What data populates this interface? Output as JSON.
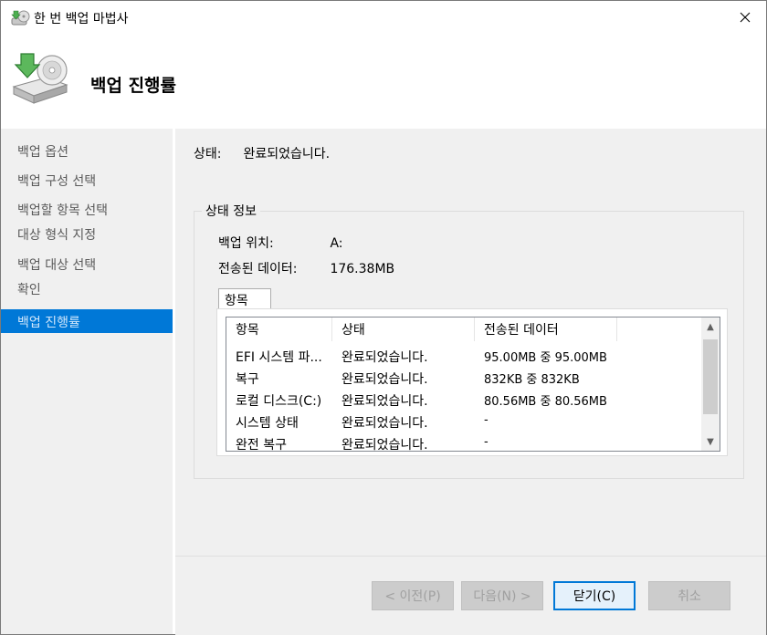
{
  "window": {
    "title": "한 번 백업 마법사"
  },
  "header": {
    "title": "백업 진행률"
  },
  "sidebar": {
    "items": [
      {
        "label": "백업 옵션"
      },
      {
        "label": "백업 구성 선택"
      },
      {
        "label": "백업할 항목 선택"
      },
      {
        "label": "대상 형식 지정"
      },
      {
        "label": "백업 대상 선택"
      },
      {
        "label": "확인"
      },
      {
        "label": "백업 진행률"
      }
    ],
    "active_index": 6
  },
  "status": {
    "label": "상태:",
    "value": "완료되었습니다."
  },
  "info_group": {
    "title": "상태 정보",
    "location_label": "백업 위치:",
    "location_value": "A:",
    "transferred_label": "전송된 데이터:",
    "transferred_value": "176.38MB"
  },
  "tabs": [
    {
      "label": "항목"
    }
  ],
  "table": {
    "columns": [
      "항목",
      "상태",
      "전송된 데이터"
    ],
    "rows": [
      [
        "EFI 시스템 파...",
        "완료되었습니다.",
        "95.00MB 중 95.00MB"
      ],
      [
        "복구",
        "완료되었습니다.",
        "832KB 중 832KB"
      ],
      [
        "로컬 디스크(C:)",
        "완료되었습니다.",
        "80.56MB 중 80.56MB"
      ],
      [
        "시스템 상태",
        "완료되었습니다.",
        "-"
      ],
      [
        "완전 복구",
        "완료되었습니다.",
        "-"
      ]
    ]
  },
  "buttons": {
    "back": "< 이전(P)",
    "next": "다음(N) >",
    "close": "닫기(C)",
    "cancel": "취소"
  },
  "colors": {
    "accent": "#0078d7",
    "panel_bg": "#f0f0f0",
    "icon_green": "#4caf50"
  }
}
